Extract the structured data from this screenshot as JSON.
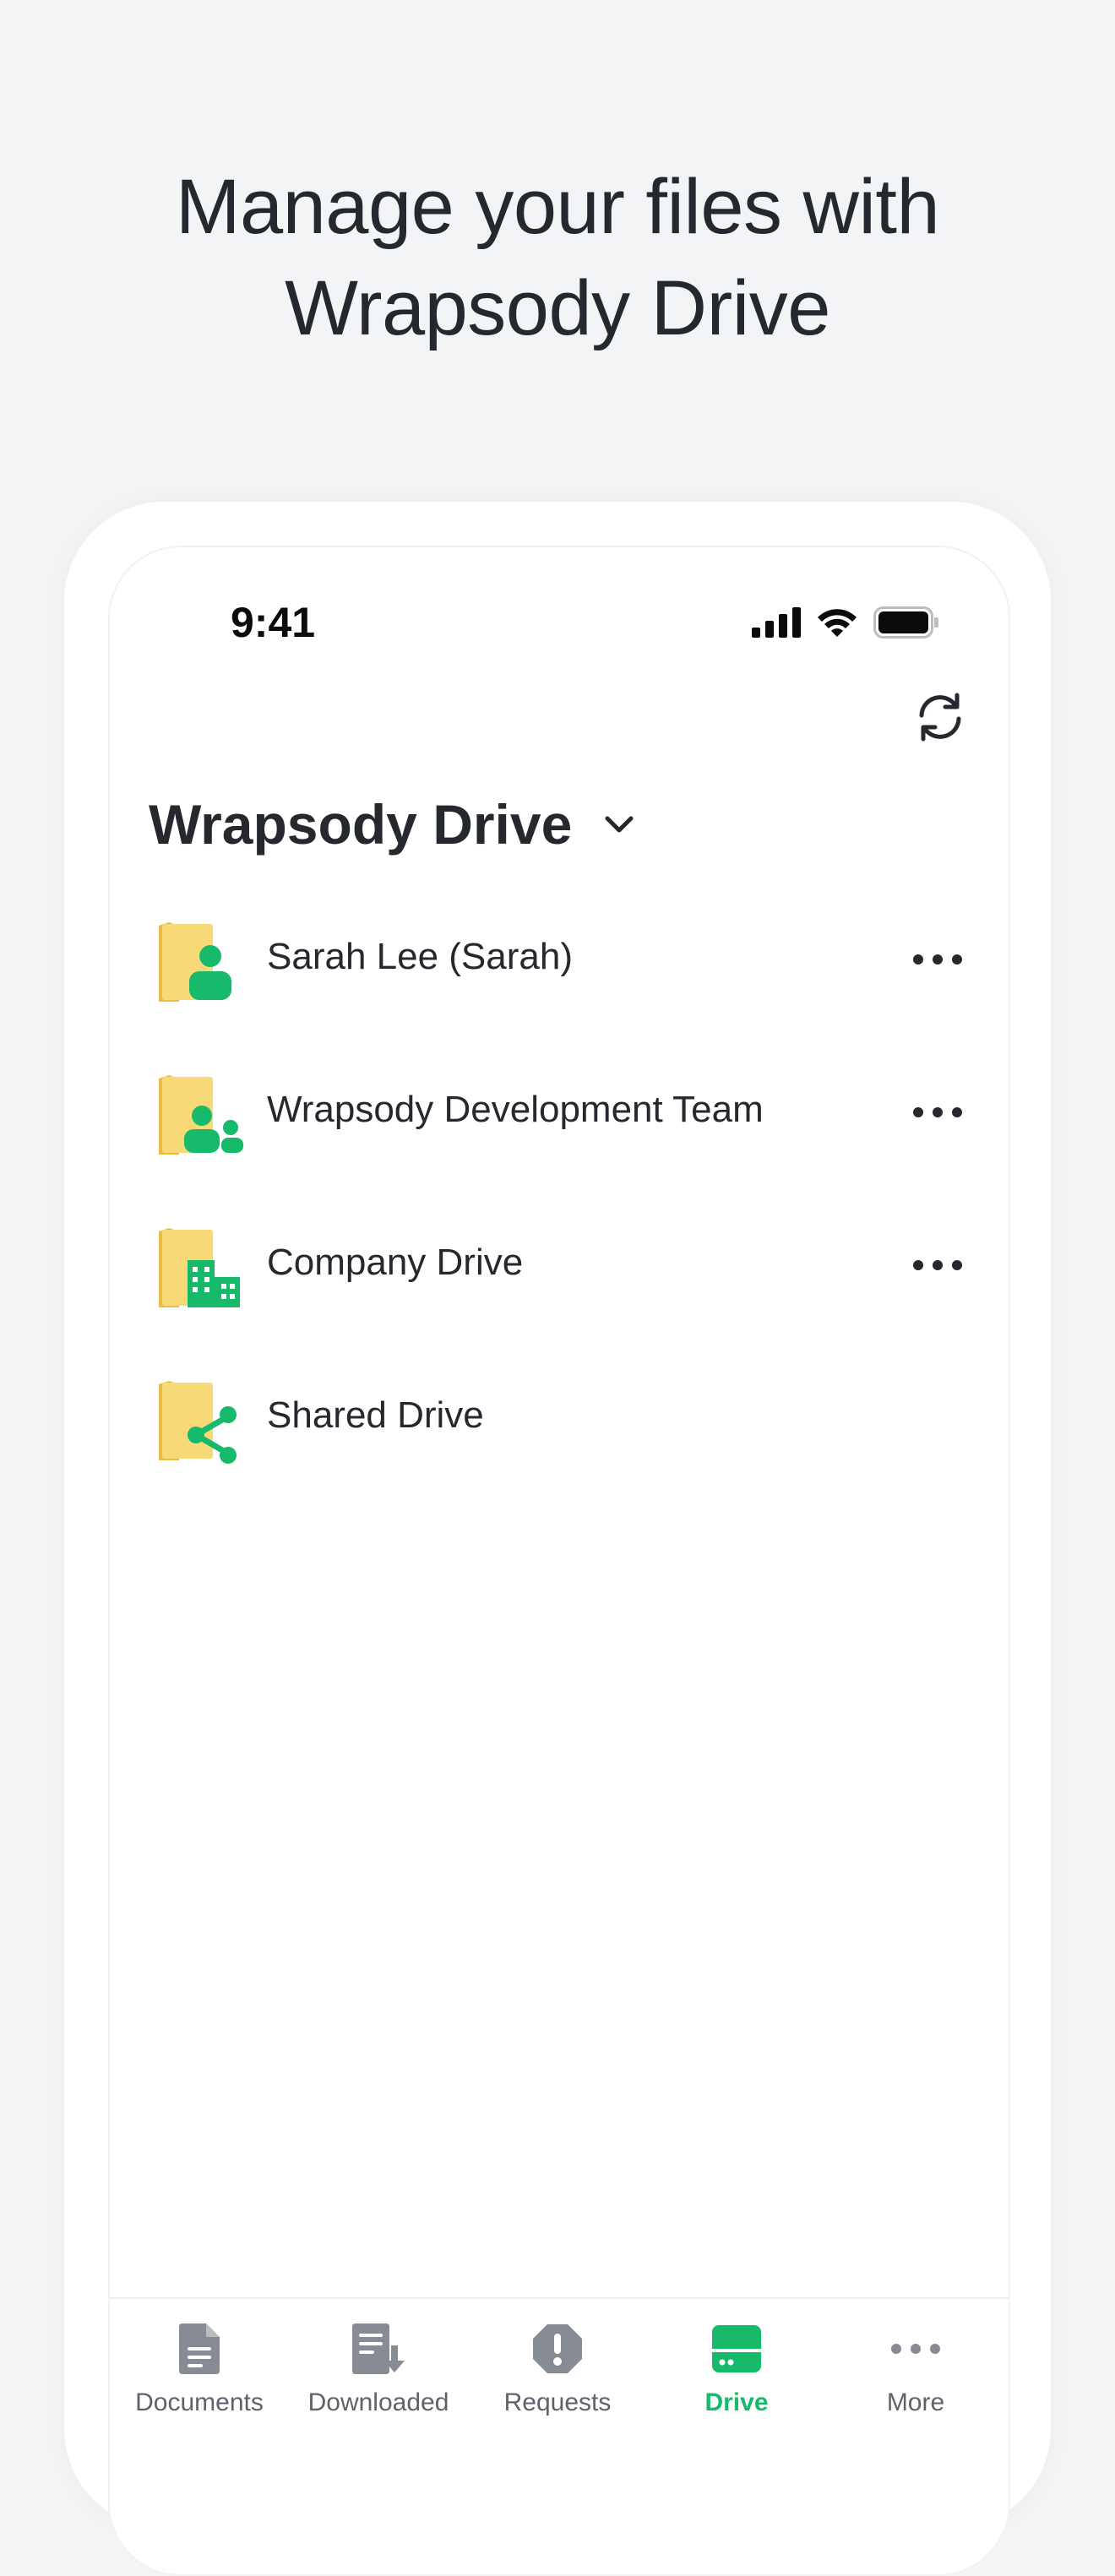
{
  "headline": {
    "line1": "Manage your files with",
    "line2": "Wrapsody Drive"
  },
  "status_bar": {
    "time": "9:41"
  },
  "header": {
    "title": "Wrapsody Drive",
    "refresh_icon": "refresh-icon",
    "dropdown_icon": "chevron-down-icon"
  },
  "drives": [
    {
      "label": "Sarah Lee (Sarah)",
      "icon": "personal-folder-icon",
      "has_more": true
    },
    {
      "label": "Wrapsody Development Team",
      "icon": "team-folder-icon",
      "has_more": true
    },
    {
      "label": "Company Drive",
      "icon": "company-folder-icon",
      "has_more": true
    },
    {
      "label": "Shared Drive",
      "icon": "shared-folder-icon",
      "has_more": false
    }
  ],
  "tabs": [
    {
      "label": "Documents",
      "icon": "document-icon",
      "active": false
    },
    {
      "label": "Downloaded",
      "icon": "downloaded-icon",
      "active": false
    },
    {
      "label": "Requests",
      "icon": "request-alert-icon",
      "active": false
    },
    {
      "label": "Drive",
      "icon": "drive-icon",
      "active": true
    },
    {
      "label": "More",
      "icon": "more-horizontal-icon",
      "active": false
    }
  ],
  "colors": {
    "accent": "#17b96b",
    "folder": "#f6d36b",
    "text": "#25282e",
    "tab_inactive": "#868b94",
    "background": "#f3f4f6"
  }
}
